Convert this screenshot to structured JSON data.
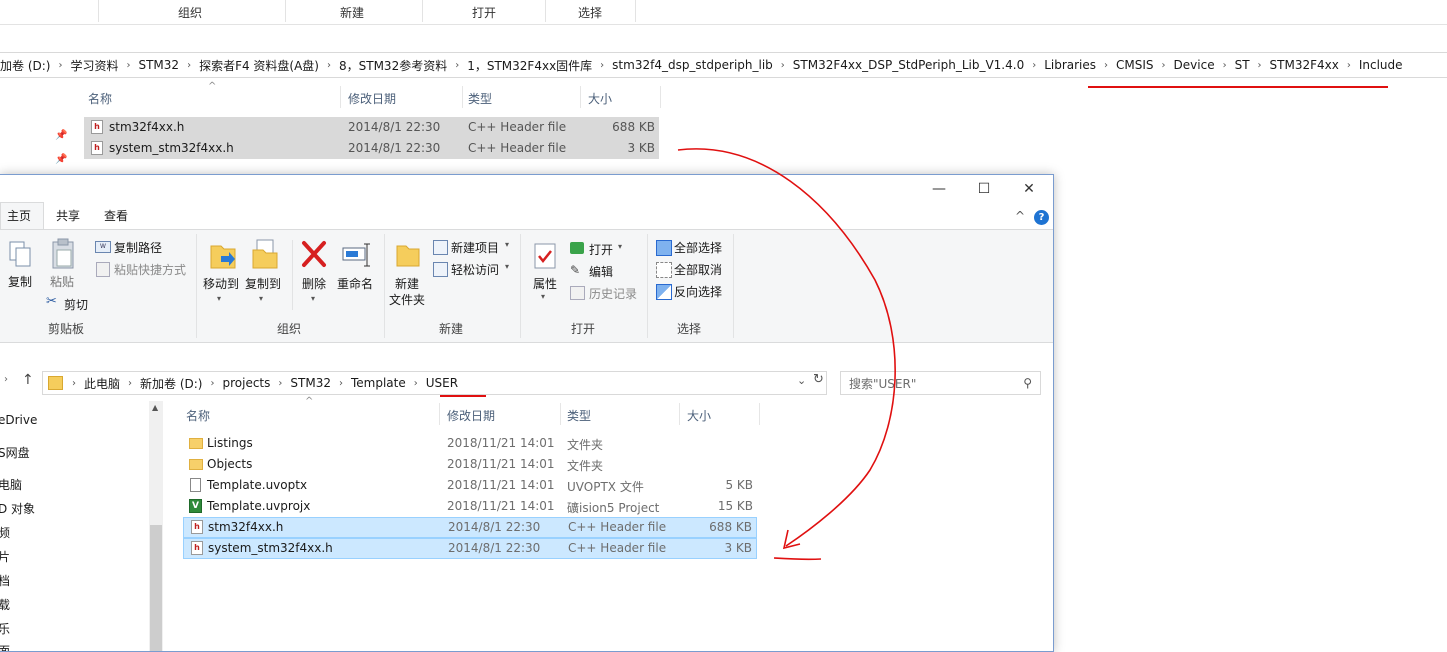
{
  "background_window": {
    "ribbon_groups": [
      "组织",
      "新建",
      "打开",
      "选择"
    ],
    "breadcrumb": [
      "加卷 (D:)",
      "学习资料",
      "STM32",
      "探索者F4 资料盘(A盘)",
      "8，STM32参考资料",
      "1，STM32F4xx固件库",
      "stm32f4_dsp_stdperiph_lib",
      "STM32F4xx_DSP_StdPeriph_Lib_V1.4.0",
      "Libraries",
      "CMSIS",
      "Device",
      "ST",
      "STM32F4xx",
      "Include"
    ],
    "columns": {
      "name": "名称",
      "date": "修改日期",
      "type": "类型",
      "size": "大小"
    },
    "files": [
      {
        "name": "stm32f4xx.h",
        "date": "2014/8/1 22:30",
        "type": "C++ Header file",
        "size": "688 KB"
      },
      {
        "name": "system_stm32f4xx.h",
        "date": "2014/8/1 22:30",
        "type": "C++ Header file",
        "size": "3 KB"
      }
    ]
  },
  "foreground_window": {
    "controls": {
      "minimize": "—",
      "maximize": "☐",
      "close": "✕",
      "collapse": "^",
      "help": "?"
    },
    "tabs": [
      "主页",
      "共享",
      "查看"
    ],
    "ribbon": {
      "clipboard": {
        "copy": "复制",
        "paste": "粘贴",
        "copy_path": "复制路径",
        "paste_shortcut": "粘贴快捷方式",
        "cut": "剪切",
        "label": "剪贴板"
      },
      "organize": {
        "move_to": "移动到",
        "copy_to": "复制到",
        "delete": "删除",
        "rename": "重命名",
        "label": "组织"
      },
      "new": {
        "new_folder_1": "新建",
        "new_folder_2": "文件夹",
        "new_item": "新建项目",
        "easy_access": "轻松访问",
        "label": "新建"
      },
      "open": {
        "properties": "属性",
        "open": "打开",
        "edit": "编辑",
        "history": "历史记录",
        "label": "打开"
      },
      "select": {
        "select_all": "全部选择",
        "select_none": "全部取消",
        "invert": "反向选择",
        "label": "选择"
      }
    },
    "address": [
      "此电脑",
      "新加卷 (D:)",
      "projects",
      "STM32",
      "Template",
      "USER"
    ],
    "search_placeholder": "搜索\"USER\"",
    "nav_items": [
      "eDrive",
      "S网盘",
      "电脑",
      "D 对象",
      "频",
      "片",
      "档",
      "载",
      "乐",
      "面"
    ],
    "columns": {
      "name": "名称",
      "date": "修改日期",
      "type": "类型",
      "size": "大小"
    },
    "files": [
      {
        "name": "Listings",
        "date": "2018/11/21 14:01",
        "type": "文件夹",
        "size": "",
        "icon": "folder-icon"
      },
      {
        "name": "Objects",
        "date": "2018/11/21 14:01",
        "type": "文件夹",
        "size": "",
        "icon": "folder-icon"
      },
      {
        "name": "Template.uvoptx",
        "date": "2018/11/21 14:01",
        "type": "UVOPTX 文件",
        "size": "5 KB",
        "icon": "file-icon"
      },
      {
        "name": "Template.uvprojx",
        "date": "2018/11/21 14:01",
        "type": "礦ision5 Project",
        "size": "15 KB",
        "icon": "keil-project-icon"
      },
      {
        "name": "stm32f4xx.h",
        "date": "2014/8/1 22:30",
        "type": "C++ Header file",
        "size": "688 KB",
        "icon": "header-file-icon"
      },
      {
        "name": "system_stm32f4xx.h",
        "date": "2014/8/1 22:30",
        "type": "C++ Header file",
        "size": "3 KB",
        "icon": "header-file-icon"
      }
    ]
  },
  "colors": {
    "annotation_red": "#e01010",
    "selection": "#cce8ff",
    "selection_border": "#99d1ff"
  }
}
